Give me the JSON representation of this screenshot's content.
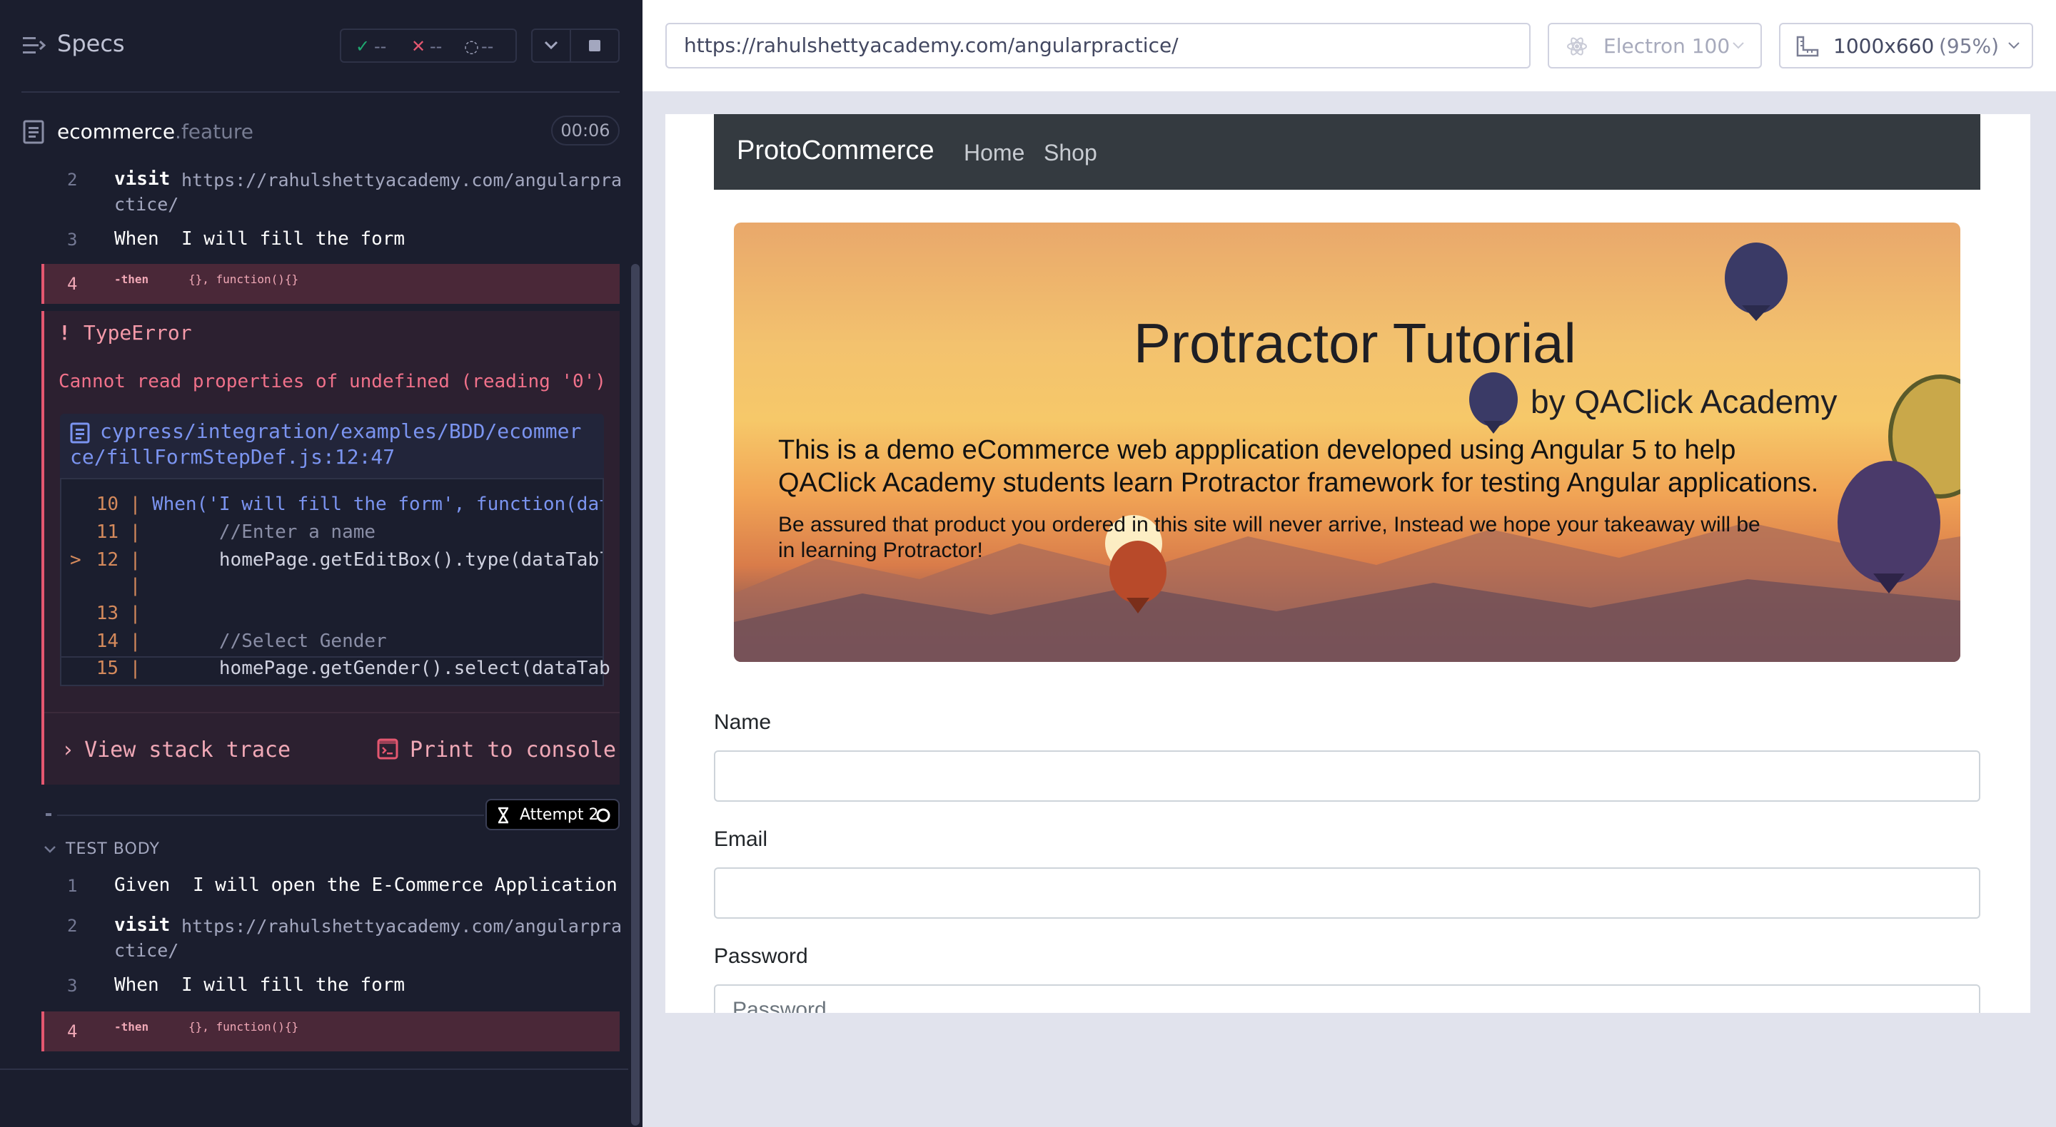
{
  "reporter": {
    "specs_label": "Specs",
    "stats": {
      "passed": "--",
      "failed": "--",
      "pending": "--"
    },
    "spec": {
      "name": "ecommerce",
      "ext": ".feature",
      "time": "00:06"
    },
    "commands_top": [
      {
        "num": "2",
        "keyword": "visit",
        "arg_line1": "https://rahulshettyacademy.com/angularpra",
        "arg_line2": "ctice/"
      },
      {
        "num": "3",
        "keyword": "When",
        "arg": "I will fill the form"
      },
      {
        "num": "4",
        "keyword": "-then",
        "arg": "{}, function(){}"
      }
    ],
    "error": {
      "bang": "!",
      "title": "TypeError",
      "message": "Cannot read properties of undefined (reading '0')",
      "file_line1": "cypress/integration/examples/BDD/ecommer",
      "file_line2": "ce/fillFormStepDef.js:12:47",
      "code": [
        {
          "num": "10",
          "marker": "",
          "text": "When('I will fill the form', function(dat"
        },
        {
          "num": "11",
          "marker": "",
          "text": "      //Enter a name"
        },
        {
          "num": "12",
          "marker": ">",
          "text": "      homePage.getEditBox().type(dataTabl"
        },
        {
          "num": "",
          "marker": "",
          "text": ""
        },
        {
          "num": "13",
          "marker": "",
          "text": ""
        },
        {
          "num": "14",
          "marker": "",
          "text": "      //Select Gender"
        },
        {
          "num": "15",
          "marker": "",
          "text": "      homePage.getGender().select(dataTab"
        }
      ],
      "view_stack": "View stack trace",
      "print_console": "Print to console"
    },
    "attempt": "Attempt 2",
    "test_body_label": "TEST BODY",
    "commands_bottom": [
      {
        "num": "1",
        "keyword": "Given",
        "arg": "I will open the E-Commerce Application"
      },
      {
        "num": "2",
        "keyword": "visit",
        "arg_line1": "https://rahulshettyacademy.com/angularpra",
        "arg_line2": "ctice/"
      },
      {
        "num": "3",
        "keyword": "When",
        "arg": "I will fill the form"
      },
      {
        "num": "4",
        "keyword": "-then",
        "arg": "{}, function(){}"
      }
    ]
  },
  "runner": {
    "url": "https://rahulshettyacademy.com/angularpractice/",
    "browser": "Electron 100",
    "viewport": "1000x660",
    "zoom": "(95%)"
  },
  "app": {
    "brand": "ProtoCommerce",
    "nav": [
      "Home",
      "Shop"
    ],
    "banner": {
      "title": "Protractor Tutorial",
      "subtitle": "by QAClick Academy",
      "p1": "This is a demo eCommerce web appplication developed using Angular 5 to help QAClick Academy students learn Protractor framework for testing Angular applications.",
      "p2": "Be assured that product you ordered in this site will never arrive, Instead we hope your takeaway will be in learning Protractor!"
    },
    "form": {
      "name_label": "Name",
      "email_label": "Email",
      "password_label": "Password",
      "password_placeholder": "Password"
    }
  },
  "colors": {
    "accent_error": "#e45770",
    "pass": "#1fa971",
    "fail": "#e45770",
    "link": "#7b94f0"
  }
}
